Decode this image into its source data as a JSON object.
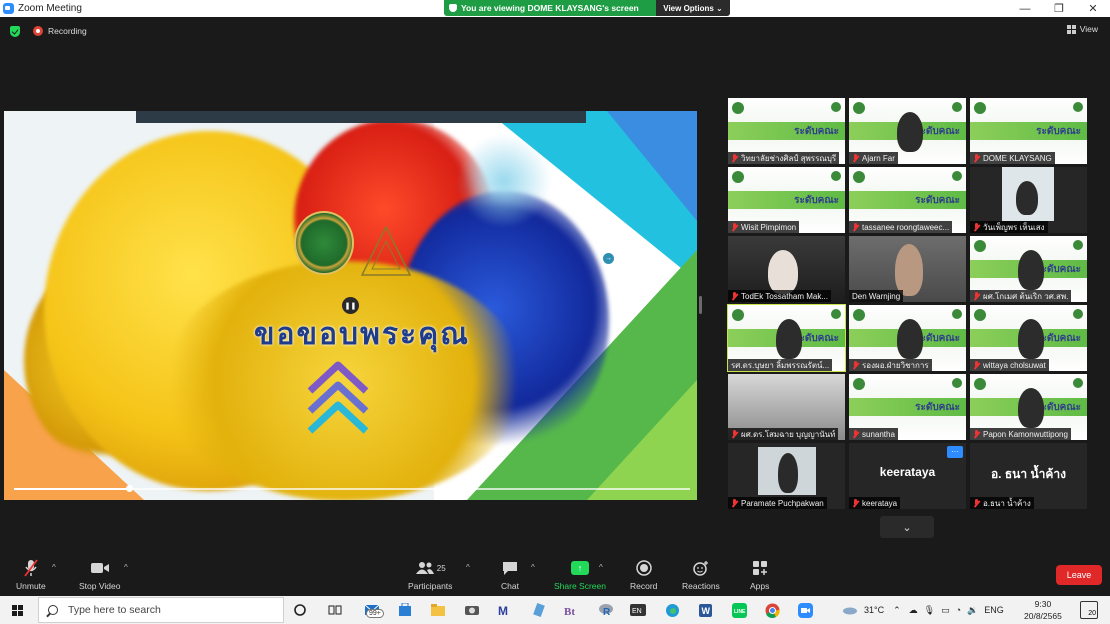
{
  "window": {
    "title": "Zoom Meeting",
    "minimize": "—",
    "maximize": "❐",
    "close": "✕"
  },
  "banner": {
    "text": "You are viewing DOME KLAYSANG's screen",
    "view_options": "View Options ⌄"
  },
  "meeting": {
    "recording_label": "Recording",
    "view_label": "View"
  },
  "shared_screen": {
    "thanks_text": "ขอขอบพระคุณ",
    "pause_symbol": "❚❚",
    "side_arrow": "→",
    "progress": 0.17
  },
  "gallery": {
    "participants": [
      {
        "name": "วิทยาลัยช่างศิลป์ สุพรรณบุรี",
        "muted": true
      },
      {
        "name": "Ajarn Far",
        "muted": true
      },
      {
        "name": "DOME KLAYSANG",
        "muted": true
      },
      {
        "name": "Wisit Pimpimon",
        "muted": true
      },
      {
        "name": "tassanee roongtaweec...",
        "muted": true
      },
      {
        "name": "วันเพ็ญพร เห็นเสง",
        "muted": true
      },
      {
        "name": "TodEk Tossatham Mak...",
        "muted": true
      },
      {
        "name": "Den Warnjing",
        "muted": false
      },
      {
        "name": "ผศ.โกเมศ ต้นเริก วศ.สพ.",
        "muted": true
      },
      {
        "name": "รศ.ดร.บุษยา ลิ้มพรรณรัตน์...",
        "muted": false
      },
      {
        "name": "รองผอ.ฝ่ายวิชาการ",
        "muted": true
      },
      {
        "name": "wittaya cholsuwat",
        "muted": true
      },
      {
        "name": "ผศ.ดร.โสมฉาย บุญญานันท์",
        "muted": true
      },
      {
        "name": "sunantha",
        "muted": true
      },
      {
        "name": "Papon Kamonwuttipong",
        "muted": true
      },
      {
        "name": "Paramate Puchpakwan",
        "muted": true
      },
      {
        "name": "keerataya",
        "muted": true,
        "big_label": "keerataya",
        "more": "···"
      },
      {
        "name": "อ.ธนา น้ำค้าง",
        "muted": true,
        "big_label": "อ. ธนา น้ำค้าง"
      }
    ],
    "next_page": "⌄"
  },
  "toolbar": {
    "unmute": "Unmute",
    "stop_video": "Stop Video",
    "participants": "Participants",
    "participants_count": "25",
    "chat": "Chat",
    "share_screen": "Share Screen",
    "record": "Record",
    "reactions": "Reactions",
    "apps": "Apps",
    "leave": "Leave",
    "caret": "^"
  },
  "taskbar": {
    "search_placeholder": "Type here to search",
    "mail_badge": "99+",
    "temperature": "31°C",
    "language": "ENG",
    "time": "9:30",
    "date": "20/8/2565",
    "notifications": "20"
  },
  "colors": {
    "meeting_bg": "#1a1a1a",
    "banner_green": "#1f9d45",
    "share_green": "#23d959",
    "leave_red": "#e02828",
    "active_speaker": "#c6e34a"
  }
}
